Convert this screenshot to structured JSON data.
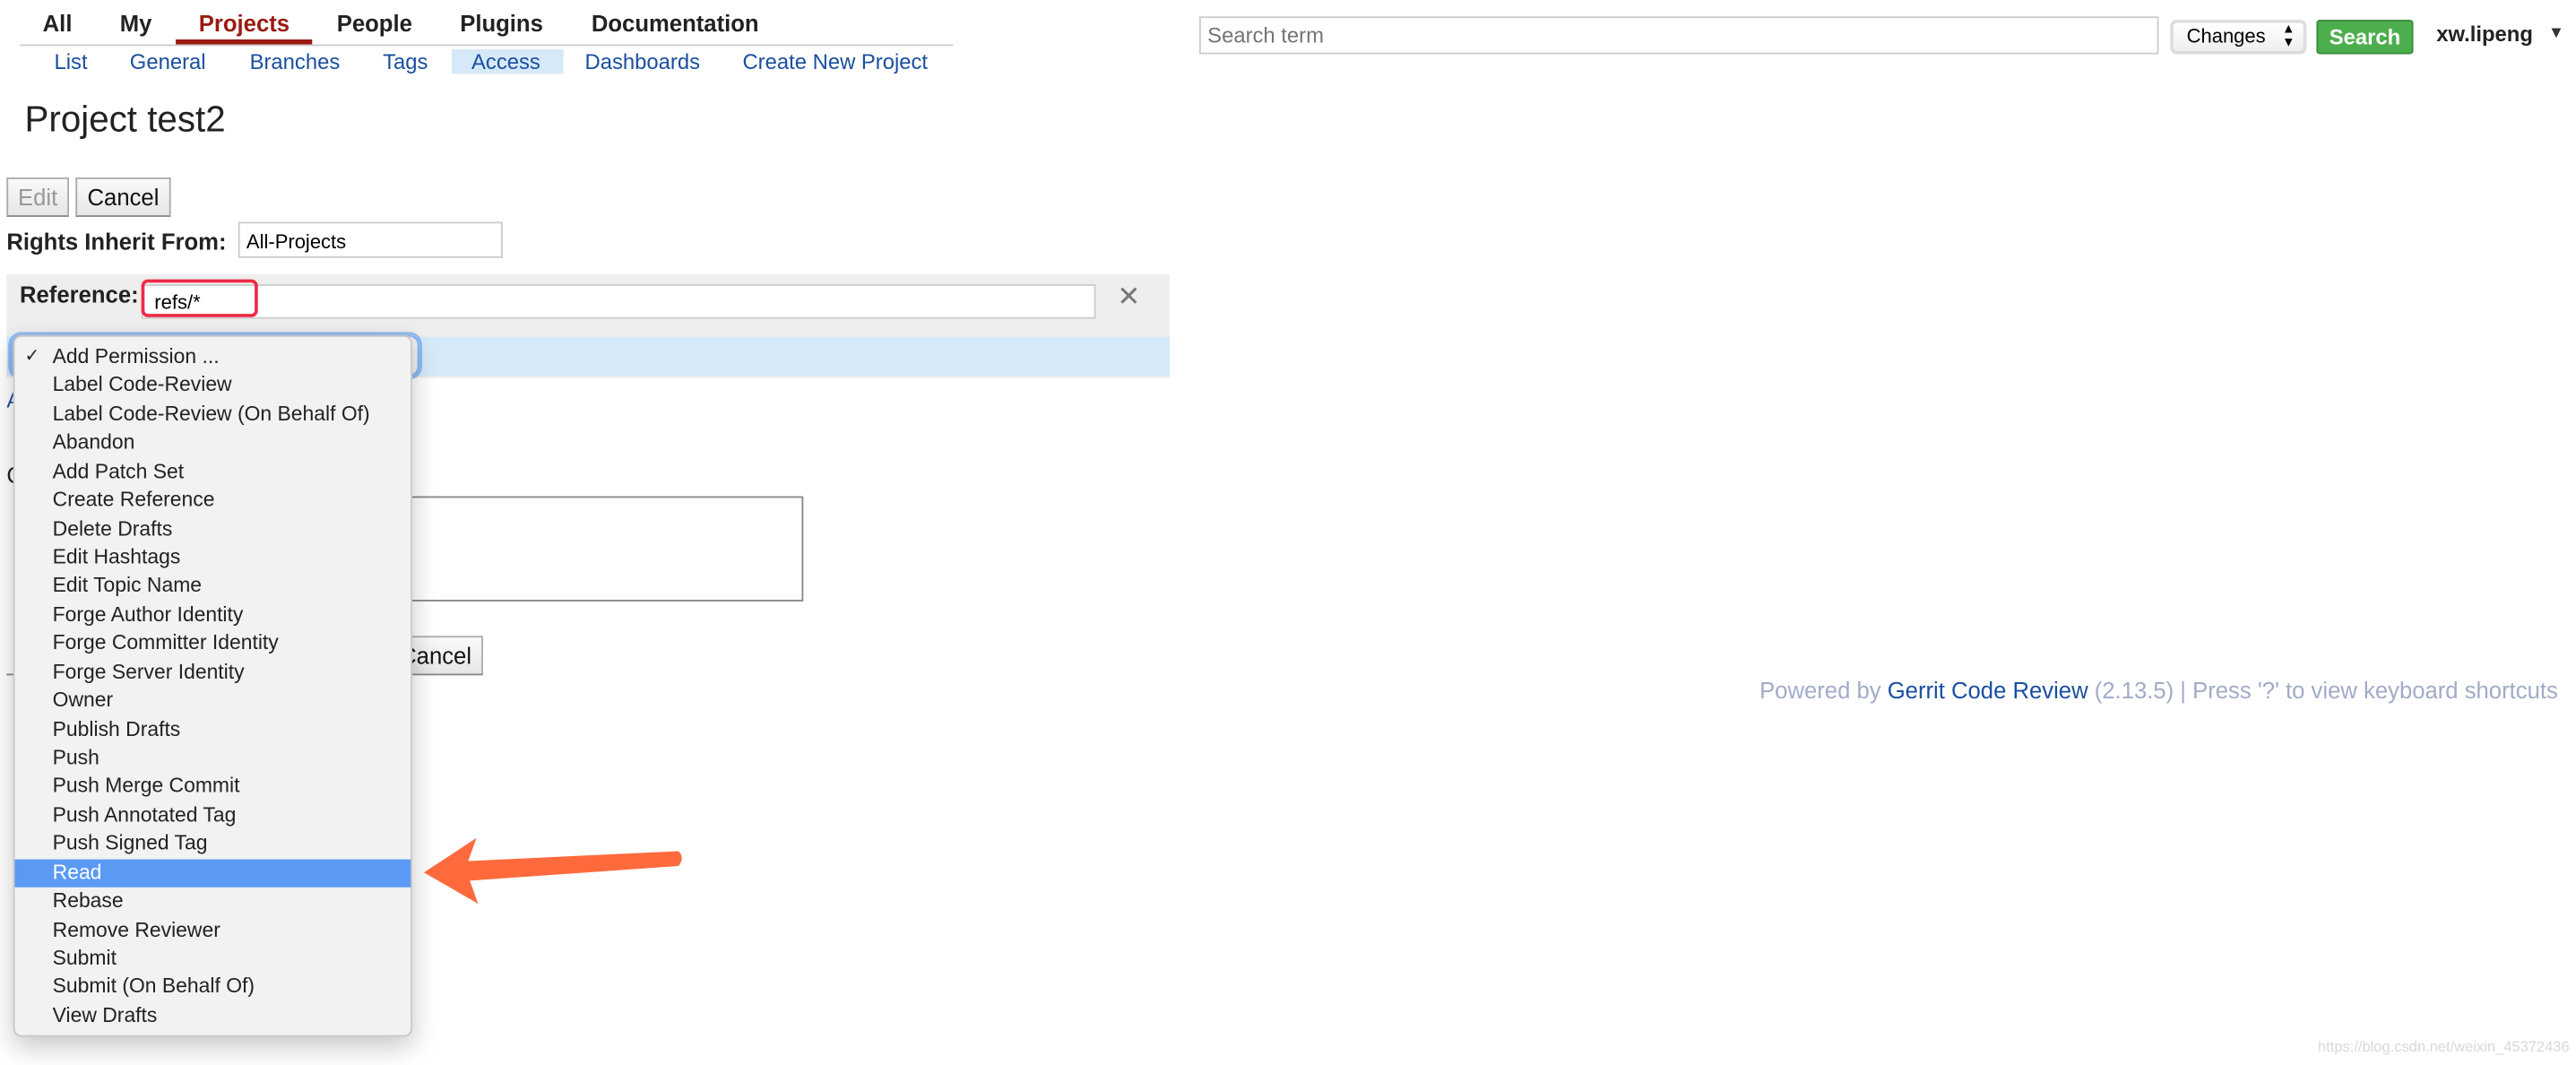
{
  "top_nav": [
    {
      "label": "All"
    },
    {
      "label": "My"
    },
    {
      "label": "Projects",
      "active": true
    },
    {
      "label": "People"
    },
    {
      "label": "Plugins"
    },
    {
      "label": "Documentation"
    }
  ],
  "sub_nav": [
    {
      "label": "List"
    },
    {
      "label": "General"
    },
    {
      "label": "Branches"
    },
    {
      "label": "Tags"
    },
    {
      "label": "Access",
      "active": true
    },
    {
      "label": "Dashboards"
    },
    {
      "label": "Create New Project"
    }
  ],
  "search": {
    "placeholder": "Search term",
    "scope": "Changes",
    "button": "Search"
  },
  "user": {
    "name": "xw.lipeng"
  },
  "page_title": "Project test2",
  "toolbar": {
    "edit": "Edit",
    "cancel": "Cancel"
  },
  "rights_inherit": {
    "label": "Rights Inherit From:",
    "value": "All-Projects"
  },
  "reference": {
    "label": "Reference:",
    "value": "refs/*"
  },
  "partial": {
    "link_fragment": "A",
    "label_fragment": "C",
    "cancel": "Cancel"
  },
  "permission_menu": {
    "selected_index": 0,
    "highlighted_index": 18,
    "items": [
      "Add Permission ...",
      "Label Code-Review",
      "Label Code-Review (On Behalf Of)",
      "Abandon",
      "Add Patch Set",
      "Create Reference",
      "Delete Drafts",
      "Edit Hashtags",
      "Edit Topic Name",
      "Forge Author Identity",
      "Forge Committer Identity",
      "Forge Server Identity",
      "Owner",
      "Publish Drafts",
      "Push",
      "Push Merge Commit",
      "Push Annotated Tag",
      "Push Signed Tag",
      "Read",
      "Rebase",
      "Remove Reviewer",
      "Submit",
      "Submit (On Behalf Of)",
      "View Drafts"
    ]
  },
  "footer": {
    "prefix": "Powered by ",
    "link": "Gerrit Code Review",
    "suffix": " (2.13.5) | Press '?' to view keyboard shortcuts"
  },
  "watermark": "https://blog.csdn.net/weixin_45372436",
  "colors": {
    "accent_red": "#9a1a10",
    "link": "#1a4fa0",
    "highlight": "#5a9af5",
    "search_green": "#4cae4c",
    "annotation_arrow": "#ff6a3d",
    "annotation_box": "#ee2a45"
  }
}
